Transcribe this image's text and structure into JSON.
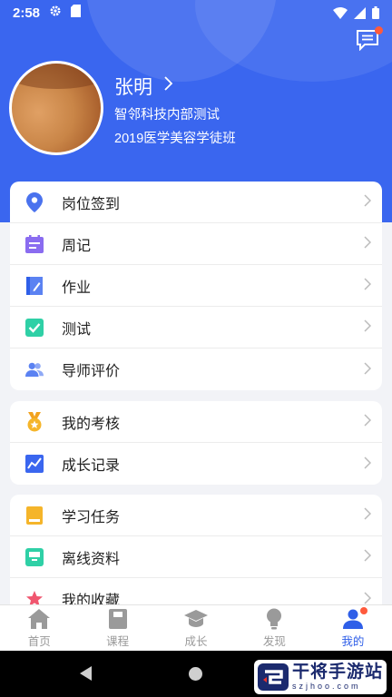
{
  "status_bar": {
    "time": "2:58"
  },
  "profile": {
    "name": "张明",
    "org": "智邻科技内部测试",
    "class": "2019医学美容学徒班"
  },
  "colors": {
    "brand_blue": "#3a66ef",
    "tab_active": "#2f5fe8",
    "badge_red": "#ff5a3c"
  },
  "menu_group_1": [
    {
      "label": "岗位签到",
      "icon": "location-pin-icon"
    },
    {
      "label": "周记",
      "icon": "calendar-notes-icon"
    },
    {
      "label": "作业",
      "icon": "notebook-edit-icon"
    },
    {
      "label": "测试",
      "icon": "checkbox-icon"
    },
    {
      "label": "导师评价",
      "icon": "people-icon"
    }
  ],
  "menu_group_2": [
    {
      "label": "我的考核",
      "icon": "medal-icon"
    },
    {
      "label": "成长记录",
      "icon": "chart-icon"
    }
  ],
  "menu_group_3": [
    {
      "label": "学习任务",
      "icon": "book-icon"
    },
    {
      "label": "离线资料",
      "icon": "archive-icon"
    },
    {
      "label": "我的收藏",
      "icon": "star-icon"
    }
  ],
  "tabs": [
    {
      "label": "首页",
      "icon": "home-icon"
    },
    {
      "label": "课程",
      "icon": "course-icon"
    },
    {
      "label": "成长",
      "icon": "graduation-cap-icon"
    },
    {
      "label": "发现",
      "icon": "lightbulb-icon"
    },
    {
      "label": "我的",
      "icon": "user-icon",
      "active": true
    }
  ],
  "watermark": {
    "title": "干将手游站",
    "domain": "szjhoo.com"
  }
}
